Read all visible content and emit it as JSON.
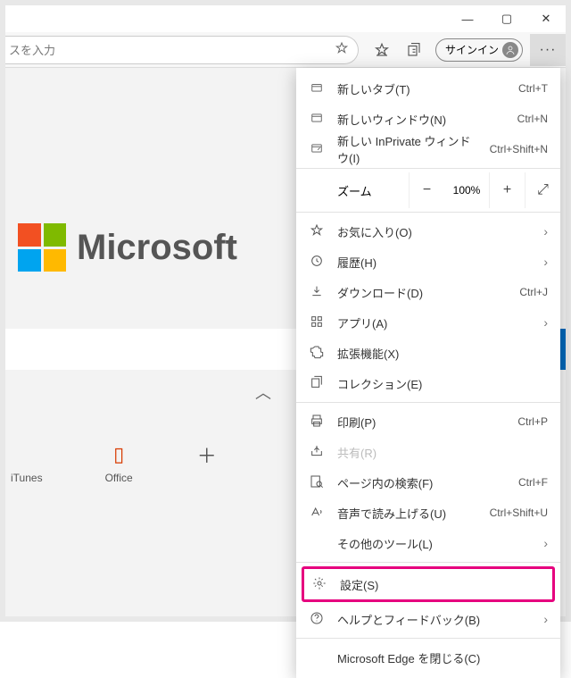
{
  "titlebar": {
    "min": "—",
    "max": "▢",
    "close": "✕"
  },
  "toolbar": {
    "address_placeholder": "スを入力",
    "signin_label": "サインイン"
  },
  "page": {
    "logo_text": "Microsoft",
    "apps": [
      {
        "name": "iTunes"
      },
      {
        "name": "Office"
      },
      {
        "name": ""
      }
    ]
  },
  "menu": {
    "new_tab": {
      "label": "新しいタブ(T)",
      "shortcut": "Ctrl+T"
    },
    "new_window": {
      "label": "新しいウィンドウ(N)",
      "shortcut": "Ctrl+N"
    },
    "new_inprivate": {
      "label": "新しい InPrivate ウィンドウ(I)",
      "shortcut": "Ctrl+Shift+N"
    },
    "zoom": {
      "label": "ズーム",
      "value": "100%"
    },
    "favorites": {
      "label": "お気に入り(O)"
    },
    "history": {
      "label": "履歴(H)"
    },
    "downloads": {
      "label": "ダウンロード(D)",
      "shortcut": "Ctrl+J"
    },
    "apps": {
      "label": "アプリ(A)"
    },
    "extensions": {
      "label": "拡張機能(X)"
    },
    "collections": {
      "label": "コレクション(E)"
    },
    "print": {
      "label": "印刷(P)",
      "shortcut": "Ctrl+P"
    },
    "share": {
      "label": "共有(R)"
    },
    "find": {
      "label": "ページ内の検索(F)",
      "shortcut": "Ctrl+F"
    },
    "read_aloud": {
      "label": "音声で読み上げる(U)",
      "shortcut": "Ctrl+Shift+U"
    },
    "more_tools": {
      "label": "その他のツール(L)"
    },
    "settings": {
      "label": "設定(S)"
    },
    "help": {
      "label": "ヘルプとフィードバック(B)"
    },
    "close_edge": {
      "label": "Microsoft Edge を閉じる(C)"
    }
  }
}
